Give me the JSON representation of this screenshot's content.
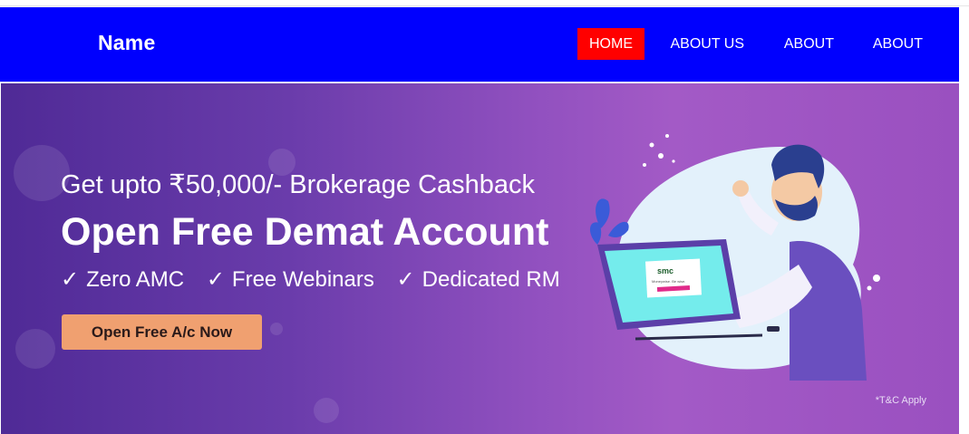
{
  "header": {
    "brand": "Name",
    "nav": [
      {
        "label": "HOME",
        "active": true
      },
      {
        "label": "ABOUT US",
        "active": false
      },
      {
        "label": "ABOUT",
        "active": false
      },
      {
        "label": "ABOUT",
        "active": false
      }
    ]
  },
  "hero": {
    "headline": "Get upto ₹50,000/- Brokerage Cashback",
    "title": "Open Free Demat Account",
    "features": [
      "Zero AMC",
      "Free Webinars",
      "Dedicated RM"
    ],
    "check_glyph": "✓",
    "cta_label": "Open Free A/c Now",
    "terms": "*T&C Apply",
    "screen_logo": "smc",
    "screen_tagline": "Moneywise. Be wise."
  },
  "colors": {
    "navbar": "#0000fe",
    "active_nav": "#ff0000",
    "cta": "#f0a070",
    "hero_start": "#4f2a96",
    "hero_end": "#a35ac6"
  },
  "icons": [
    "check-icon",
    "person-illustration",
    "computer-monitor"
  ]
}
